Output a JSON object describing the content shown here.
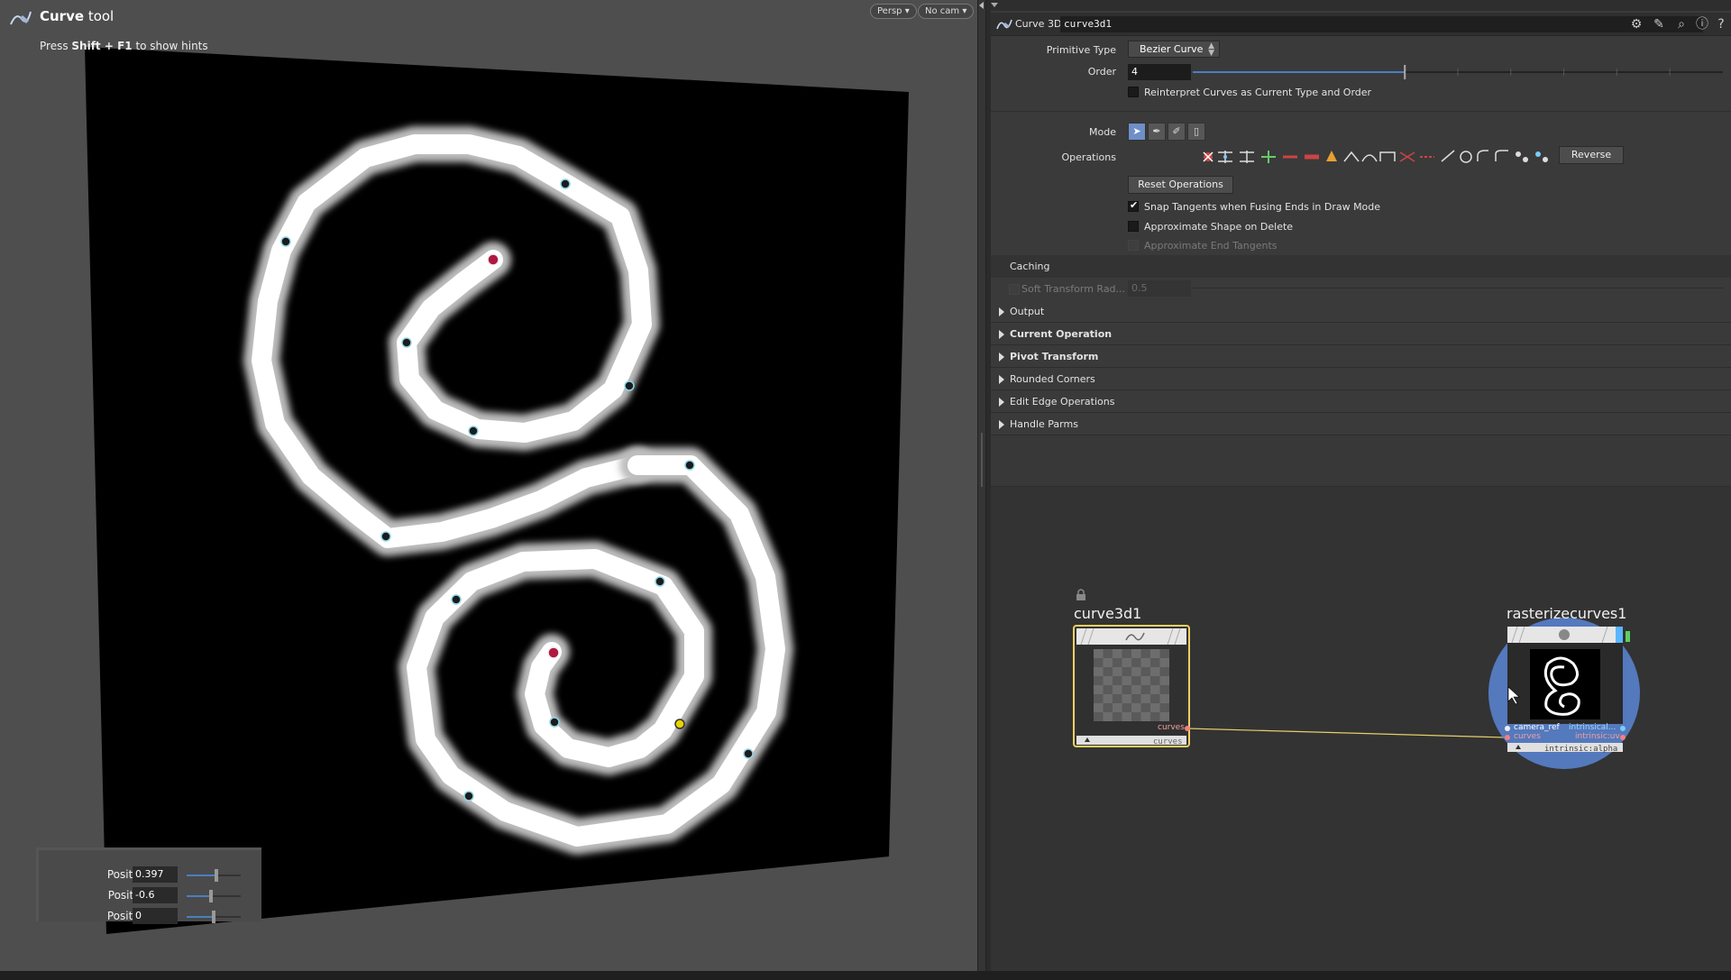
{
  "viewport": {
    "tool_title_bold": "Curve",
    "tool_title_rest": " tool",
    "hint_prefix": "Press ",
    "hint_keys": "Shift + F1",
    "hint_suffix": " to show hints",
    "persp_label": "Persp",
    "cam_label": "No cam",
    "position": [
      {
        "label": "Position (X)",
        "value": "0.397",
        "slider": 0.55
      },
      {
        "label": "Position (Y)",
        "value": "-0.6",
        "slider": 0.45
      },
      {
        "label": "Position (Z)",
        "value": "0",
        "slider": 0.5
      }
    ],
    "icons": {
      "tool": "curve-tool-icon",
      "dropdown": "caret-down-icon"
    }
  },
  "params": {
    "node_type": "Curve 3D",
    "node_name": "curve3d1",
    "header_tools": [
      "gear-icon",
      "brush-icon",
      "search-icon",
      "info-icon",
      "help-icon"
    ],
    "primitive_type_label": "Primitive Type",
    "primitive_type_value": "Bezier Curve",
    "order_label": "Order",
    "order_value": "4",
    "order_slider": 0.4,
    "reinterpret_label": "Reinterpret Curves as Current Type and Order",
    "mode_label": "Mode",
    "operations_label": "Operations",
    "reverse_label": "Reverse",
    "reset_ops_label": "Reset Operations",
    "snap_tangents_label": "Snap Tangents when Fusing Ends in Draw Mode",
    "approx_shape_label": "Approximate Shape on Delete",
    "approx_tangents_label": "Approximate End Tangents",
    "caching_label": "Caching",
    "soft_transform_label": "Soft Transform Rad...",
    "soft_transform_value": "0.5",
    "folders": [
      {
        "label": "Output",
        "bold": false
      },
      {
        "label": "Current Operation",
        "bold": true
      },
      {
        "label": "Pivot Transform",
        "bold": true
      },
      {
        "label": "Rounded Corners",
        "bold": false
      },
      {
        "label": "Edit Edge Operations",
        "bold": false
      },
      {
        "label": "Handle Parms",
        "bold": false
      }
    ],
    "colors": {
      "accent": "#4a7fc0",
      "selected_mode": "#6e8fc7"
    }
  },
  "network": {
    "node1": {
      "name": "curve3d1",
      "output": "curves",
      "footer": "curves",
      "border": "#f0d060"
    },
    "node2": {
      "name": "rasterizecurves1",
      "input_1": "camera_ref",
      "input_2": "curves",
      "output_1": "intrinsical...",
      "output_2": "intrinsic:uv",
      "footer": "intrinsic:alpha",
      "highlight": "#5b86d6"
    },
    "icons": [
      "lock-icon",
      "cursor-icon"
    ]
  }
}
